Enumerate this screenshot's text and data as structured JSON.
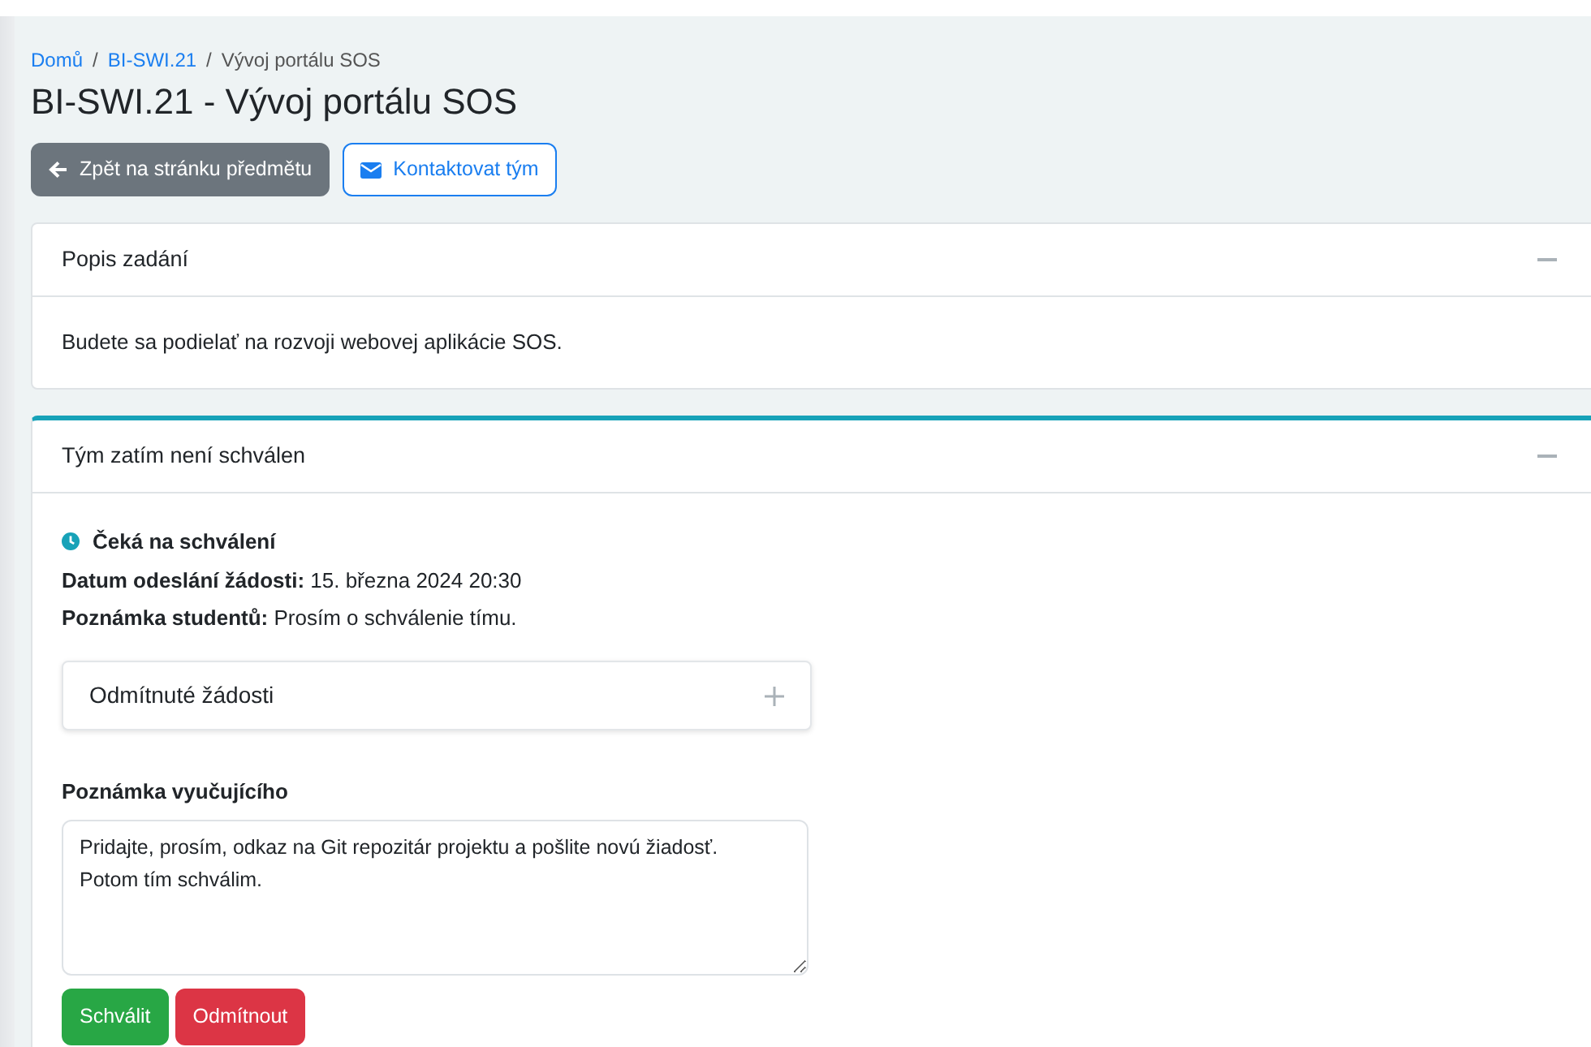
{
  "breadcrumb": [
    {
      "label": "Domů",
      "kind": "link"
    },
    {
      "label": "/",
      "kind": "separator"
    },
    {
      "label": "BI-SWI.21",
      "kind": "link"
    },
    {
      "label": "/",
      "kind": "separator"
    },
    {
      "label": "Vývoj portálu SOS",
      "kind": "current"
    }
  ],
  "title": "BI-SWI.21 - Vývoj portálu SOS",
  "actions": [
    {
      "label": "Zpět na stránku předmětu",
      "kind": "back"
    },
    {
      "label": "Kontaktovat tým",
      "kind": "contact"
    }
  ],
  "description_card": {
    "title": "Popis zadání",
    "expanded": true,
    "text": "Budete sa podielať na rozvoji webovej aplikácie SOS."
  },
  "approval_card": {
    "title": "Tým zatím není schválen",
    "expanded": true,
    "highlighted": true,
    "status": "Čeká na schválení",
    "details": [
      {
        "label": "Datum odeslání žádosti:",
        "value": "15. března 2024 20:30"
      },
      {
        "label": "Poznámka studentů:",
        "value": "Prosím o schválenie tímu."
      }
    ],
    "rejected_panel": {
      "title": "Odmítnuté žádosti",
      "expanded": false
    },
    "note_label": "Poznámka vyučujícího",
    "note_value": "Pridajte, prosím, odkaz na Git repozitár projektu a pošlite novú žiadosť.\nPotom tím schválim.",
    "buttons": [
      {
        "label": "Schválit",
        "kind": "approve"
      },
      {
        "label": "Odmítnout",
        "kind": "reject"
      }
    ]
  }
}
